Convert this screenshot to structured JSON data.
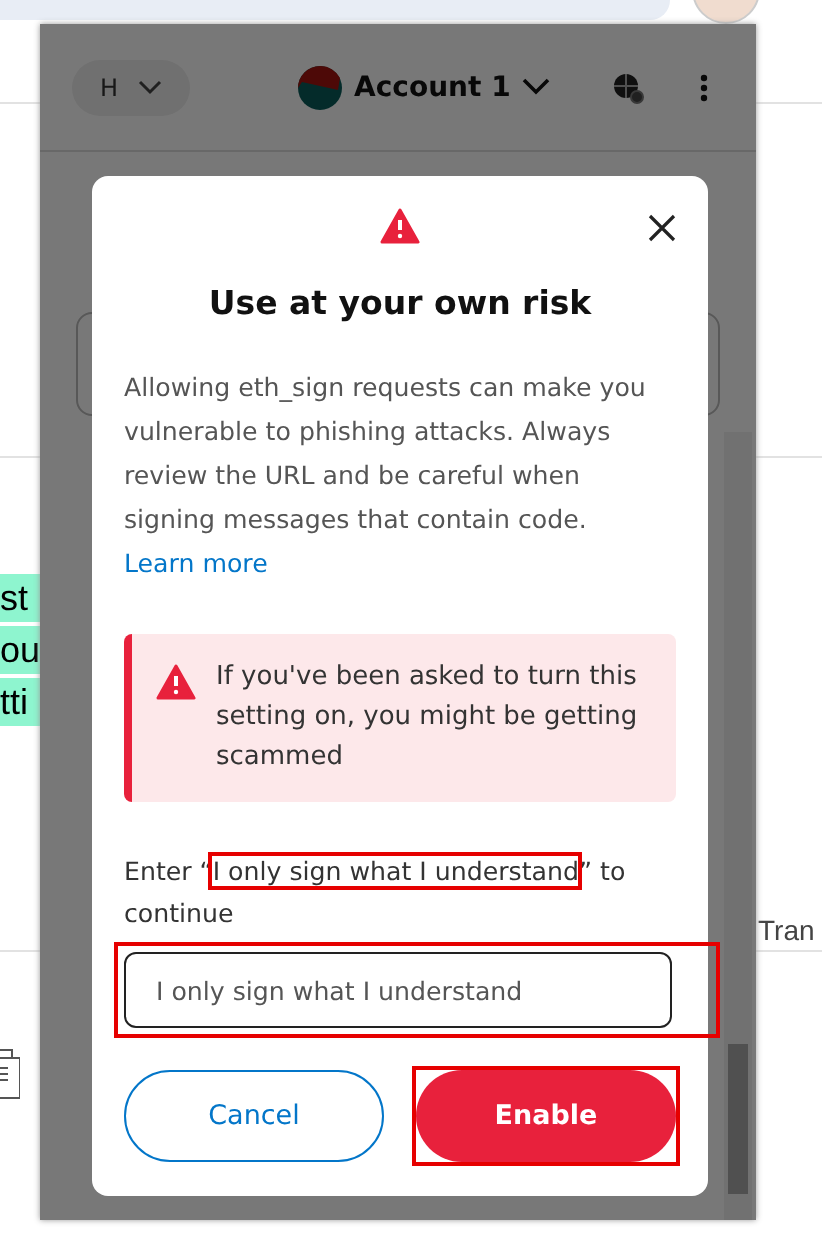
{
  "background_page": {
    "fragments": [
      {
        "text": "st",
        "highlighted": true
      },
      {
        "text": "ou",
        "highlighted": true
      },
      {
        "text": "tti",
        "highlighted": true
      }
    ],
    "right_fragment": "Tran"
  },
  "popup_header": {
    "network": "H",
    "account": "Account 1"
  },
  "dialog": {
    "title": "Use at your own risk",
    "description": "Allowing eth_sign requests can make you vulnerable to phishing attacks. Always review the URL and be careful when signing messages that contain code.",
    "link": "Learn more",
    "alert": "If you've been asked to turn this setting on, you might be getting scammed",
    "prompt": {
      "before": "Enter “",
      "phrase": "I only sign what I understand",
      "after": "” to continue",
      "highlighted": true
    },
    "input": {
      "value": "I only sign what I understand",
      "highlighted": true
    },
    "buttons": [
      {
        "label": "Cancel",
        "kind": "secondary",
        "highlighted": false
      },
      {
        "label": "Enable",
        "kind": "danger",
        "highlighted": true
      }
    ]
  }
}
